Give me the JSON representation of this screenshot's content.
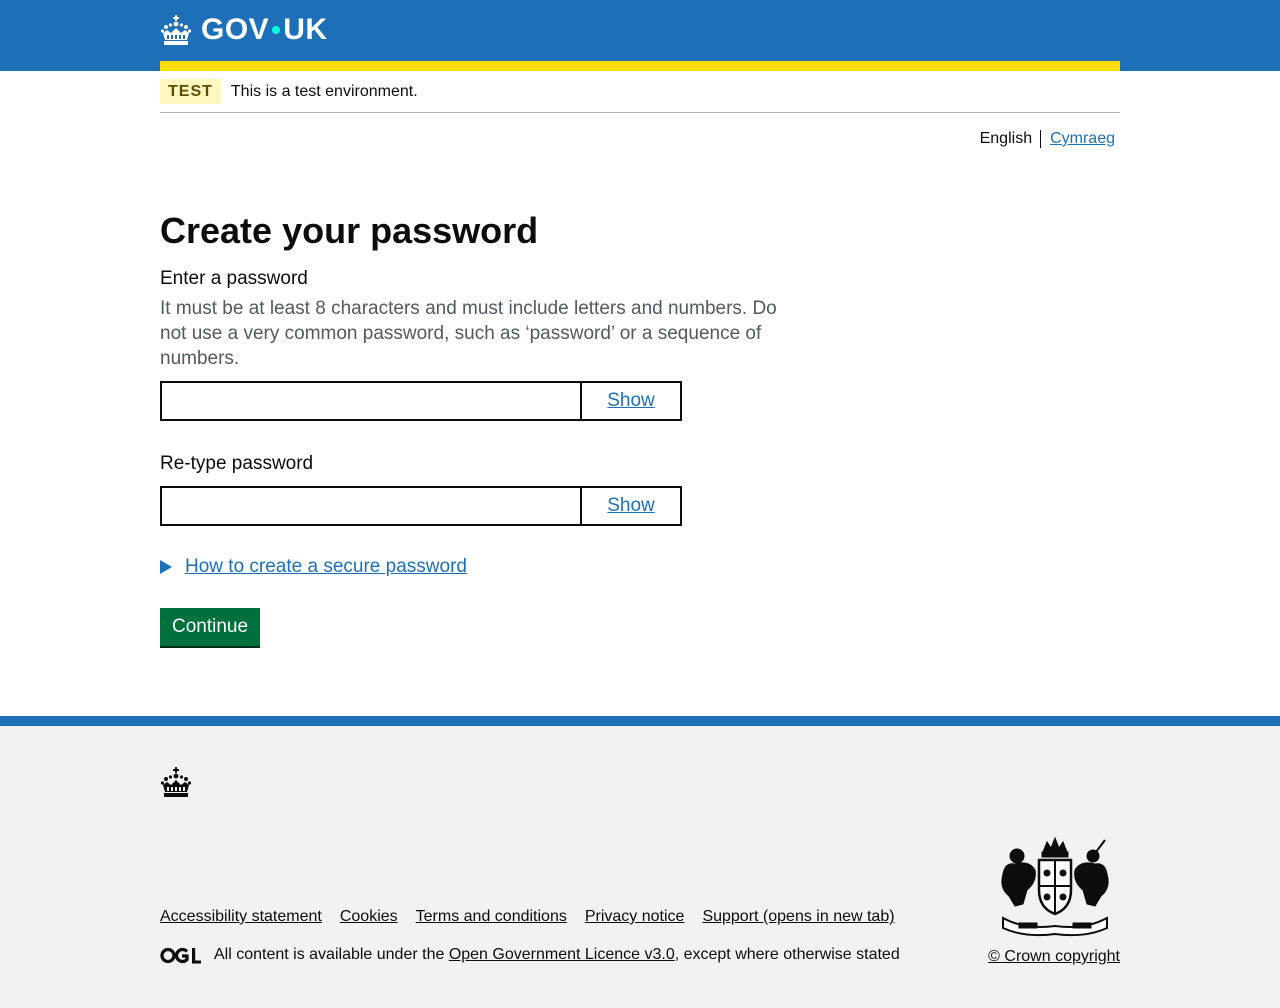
{
  "header": {
    "logo_text_left": "GOV",
    "logo_text_right": "UK"
  },
  "phase_banner": {
    "tag": "TEST",
    "text": "This is a test environment."
  },
  "language": {
    "current": "English",
    "alternate": "Cymraeg"
  },
  "main": {
    "title": "Create your password",
    "password_label": "Enter a password",
    "password_hint": "It must be at least 8 characters and must include letters and numbers. Do not use a very common password, such as ‘password’ or a sequence of numbers.",
    "password_value": "",
    "show_label": "Show",
    "retype_label": "Re-type password",
    "retype_value": "",
    "retype_show_label": "Show",
    "details_summary": "How to create a secure password",
    "continue_label": "Continue"
  },
  "footer": {
    "links": [
      "Accessibility statement",
      "Cookies",
      "Terms and conditions",
      "Privacy notice",
      "Support (opens in new tab)"
    ],
    "licence_prefix": "All content is available under the ",
    "licence_link": "Open Government Licence v3.0",
    "licence_suffix": ", except where otherwise stated",
    "copyright": "© Crown copyright"
  },
  "icons": {
    "crown": "crown-icon",
    "ogl": "ogl-logo-icon",
    "crest": "royal-coat-of-arms-icon",
    "details_arrow": "triangle-right-icon"
  },
  "colors": {
    "brand_blue": "#1d70b8",
    "stripe_yellow": "#ffdd00",
    "button_green": "#00703c",
    "link_blue": "#1d70b8",
    "footer_bg": "#f3f2f1",
    "tag_bg": "#fff7bf"
  }
}
